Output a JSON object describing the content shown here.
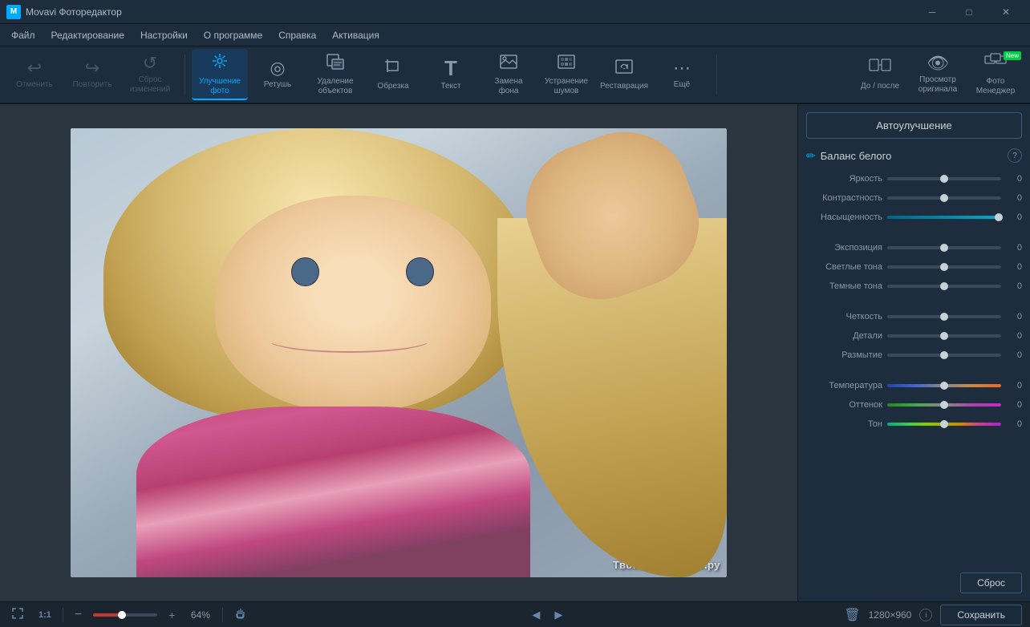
{
  "titlebar": {
    "title": "Movavi Фоторедактор",
    "min_label": "─",
    "max_label": "□",
    "close_label": "✕"
  },
  "menubar": {
    "items": [
      "Файл",
      "Редактирование",
      "Настройки",
      "О программе",
      "Справка",
      "Активация"
    ]
  },
  "toolbar": {
    "undo_label": "Отменить",
    "redo_label": "Повторить",
    "reset_label": "Сброс\nизменений",
    "enhance_label": "Улучшение\nфото",
    "retouch_label": "Ретушь",
    "remove_objects_label": "Удаление\nобъектов",
    "crop_label": "Обрезка",
    "text_label": "Текст",
    "replace_bg_label": "Замена\nфона",
    "denoise_label": "Устранение\nшумов",
    "restore_label": "Реставрация",
    "more_label": "Ещё",
    "before_after_label": "До / после",
    "view_original_label": "Просмотр\nоригинала",
    "photo_manager_label": "Фото\nМенеджер",
    "new_badge": "New"
  },
  "right_panel": {
    "auto_enhance_label": "Автоулучшение",
    "white_balance_label": "Баланс белого",
    "help_label": "?",
    "reset_label": "Сброс",
    "sliders": [
      {
        "label": "Яркость",
        "value": "0",
        "type": "gray",
        "fill_pct": 50
      },
      {
        "label": "Контрастность",
        "value": "0",
        "type": "gray",
        "fill_pct": 50
      },
      {
        "label": "Насыщенность",
        "value": "0",
        "type": "cyan",
        "fill_pct": 100
      },
      {
        "label": "Экспозиция",
        "value": "0",
        "type": "gray",
        "fill_pct": 50
      },
      {
        "label": "Светлые тона",
        "value": "0",
        "type": "gray",
        "fill_pct": 50
      },
      {
        "label": "Темные тона",
        "value": "0",
        "type": "gray",
        "fill_pct": 50
      },
      {
        "label": "Четкость",
        "value": "0",
        "type": "gray",
        "fill_pct": 50
      },
      {
        "label": "Детали",
        "value": "0",
        "type": "gray",
        "fill_pct": 50
      },
      {
        "label": "Размытие",
        "value": "0",
        "type": "gray",
        "fill_pct": 50
      },
      {
        "label": "Температура",
        "value": "0",
        "type": "temp",
        "fill_pct": 50
      },
      {
        "label": "Оттенок",
        "value": "0",
        "type": "tint",
        "fill_pct": 50
      },
      {
        "label": "Тон",
        "value": "0",
        "type": "tone",
        "fill_pct": 50
      }
    ]
  },
  "statusbar": {
    "fit_label": "⛶",
    "zoom_fit_label": "1:1",
    "zoom_out_label": "−",
    "zoom_pct": "64%",
    "zoom_in_label": "+",
    "hand_label": "✋",
    "prev_label": "◀",
    "next_label": "▶",
    "delete_label": "🗑",
    "dimensions": "1280×960",
    "info_label": "i",
    "save_label": "Сохранить"
  },
  "watermark": {
    "text": "ТвоиПрограммы.ру"
  },
  "icons": {
    "undo": "↩",
    "redo": "↪",
    "reset": "↺",
    "enhance": "✦",
    "retouch": "◎",
    "remove": "⊠",
    "crop": "⊡",
    "text": "T",
    "replace_bg": "⬡",
    "denoise": "⊞",
    "restore": "⊛",
    "more": "⋯",
    "before_after": "⊟",
    "view_original": "👁",
    "photo_manager": "⊞",
    "pencil": "✏"
  }
}
